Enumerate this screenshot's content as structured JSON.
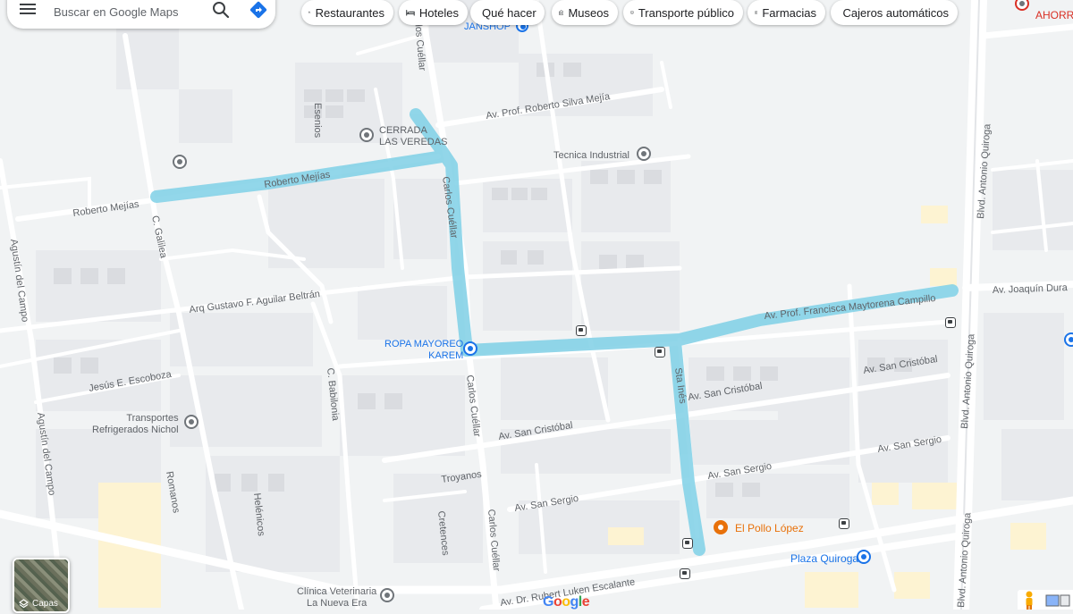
{
  "search": {
    "placeholder": "Buscar en Google Maps"
  },
  "chips": [
    {
      "label": "Restaurantes",
      "icon": "fork-knife-icon"
    },
    {
      "label": "Hoteles",
      "icon": "bed-icon"
    },
    {
      "label": "Qué hacer",
      "icon": "camera-icon"
    },
    {
      "label": "Museos",
      "icon": "museum-icon"
    },
    {
      "label": "Transporte público",
      "icon": "bus-icon"
    },
    {
      "label": "Farmacias",
      "icon": "pharmacy-icon"
    },
    {
      "label": "Cajeros automáticos",
      "icon": "atm-icon"
    }
  ],
  "layers": {
    "label": "Capas"
  },
  "logo": "Google",
  "streets": {
    "carlos_cuellar": "Carlos Cuéllar",
    "av_roberto_silva": "Av. Prof. Roberto Silva Mejía",
    "roberto_mejias": "Roberto Mejías",
    "c_galilea": "C. Galilea",
    "agustin_del_campo": "Agustín del Campo",
    "arq_gustavo": "Arq Gustavo F. Aguilar Beltrán",
    "jesus_escoboza": "Jesús E. Escoboza",
    "c_babilonia": "C. Babilonia",
    "av_san_cristobal": "Av. San Cristóbal",
    "av_san_sergio": "Av. San Sergio",
    "troyanos": "Troyanos",
    "cretences": "Cretences",
    "helenicos": "Helénicos",
    "romanos": "Romanos",
    "esenios": "Esenios",
    "sta_ines": "Sta Inés",
    "av_francisca": "Av. Prof. Francisca Maytorena Campillo",
    "av_joaquin": "Av. Joaquín Dura",
    "blvd_antonio_quiroga": "Blvd. Antonio Quiroga",
    "av_rubert": "Av. Dr. Rubert Luken Escalante"
  },
  "places": {
    "janshop": "JANSHOP",
    "cerrada": "CERRADA\nLAS VEREDAS",
    "tecnica": "Tecnica Industrial",
    "ropa": "ROPA MAYOREO\nKAREM",
    "transportes": "Transportes\nRefrigerados Nichol",
    "pollo": "El Pollo López",
    "plaza": "Plaza Quiroga",
    "clinica": "Clínica Veterinaria\nLa Nueva Era",
    "ahorro": "AHORR"
  },
  "colors": {
    "route": "#7fd0e6",
    "road": "#ffffff",
    "background": "#f1f3f4",
    "block": "#e8eaed",
    "building_yellow": "#fdf3d2",
    "poi_blue": "#1a73e8",
    "poi_orange": "#e8710a"
  }
}
